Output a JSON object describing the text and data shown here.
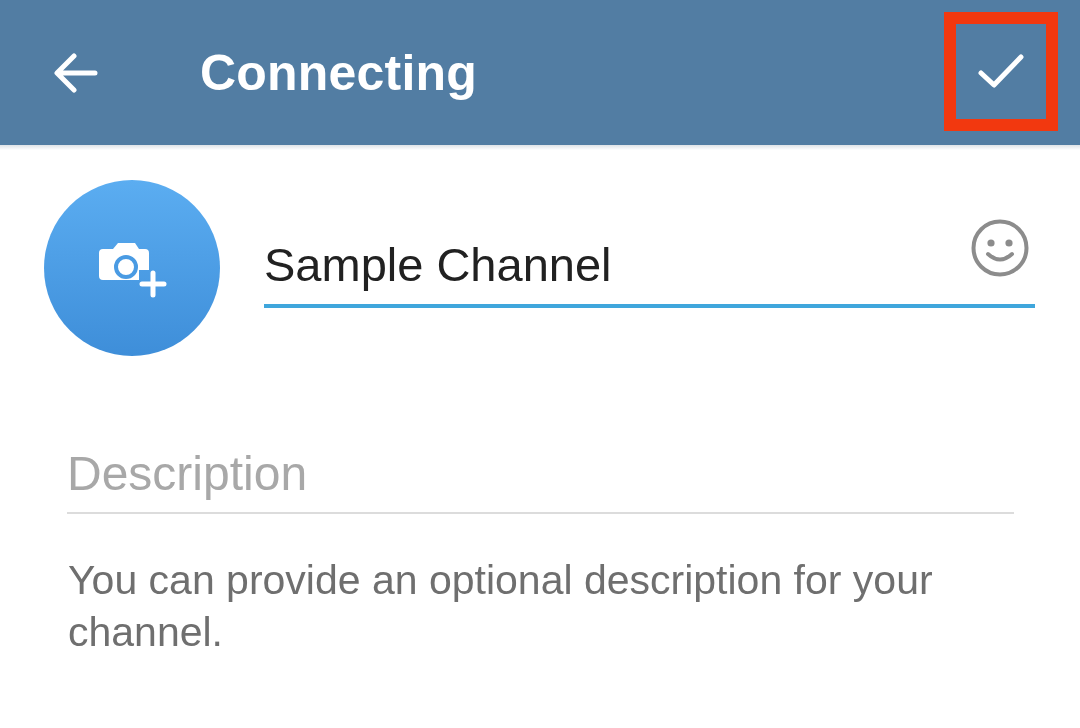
{
  "toolbar": {
    "title": "Connecting",
    "done_button": {
      "highlighted": true
    }
  },
  "name_field": {
    "value": "Sample Channel",
    "focused": true
  },
  "description_field": {
    "placeholder": "Description"
  },
  "hint": "You can provide an optional description for your channel."
}
